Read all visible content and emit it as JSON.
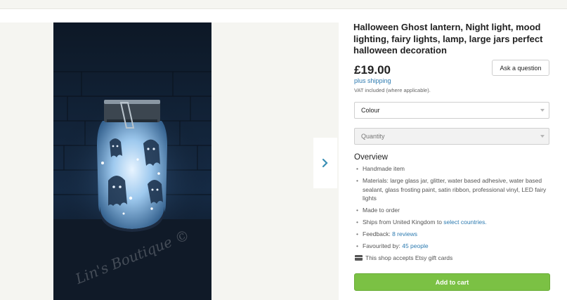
{
  "listing": {
    "title": "Halloween Ghost lantern, Night light, mood lighting, fairy lights, lamp, large jars perfect halloween decoration",
    "price": "£19.00",
    "shipping": "plus shipping",
    "vat_note": "VAT included (where applicable).",
    "ask_button": "Ask a question",
    "colour_select": "Colour",
    "quantity_select": "Quantity",
    "overview_heading": "Overview",
    "details": {
      "handmade": "Handmade item",
      "materials": "Materials: large glass jar, glitter, water based adhesive, water based sealant, glass frosting paint, satin ribbon, professional vinyl, LED fairy lights",
      "made_to_order": "Made to order",
      "ships_prefix": "Ships from United Kingdom to ",
      "ships_link": "select countries.",
      "feedback_prefix": "Feedback: ",
      "feedback_link": "8 reviews",
      "favourited_prefix": "Favourited by: ",
      "favourited_link": "45 people"
    },
    "gift_cards": "This shop accepts Etsy gift cards",
    "add_to_cart": "Add to cart"
  },
  "photo": {
    "watermark": "Lin's Boutique ©"
  },
  "icons": {
    "next": "chevron-right-icon",
    "gift": "gift-card-icon"
  },
  "colors": {
    "link": "#2c7ab0",
    "cart_button": "#7bc144",
    "gallery_bg": "#f5f5f1"
  }
}
